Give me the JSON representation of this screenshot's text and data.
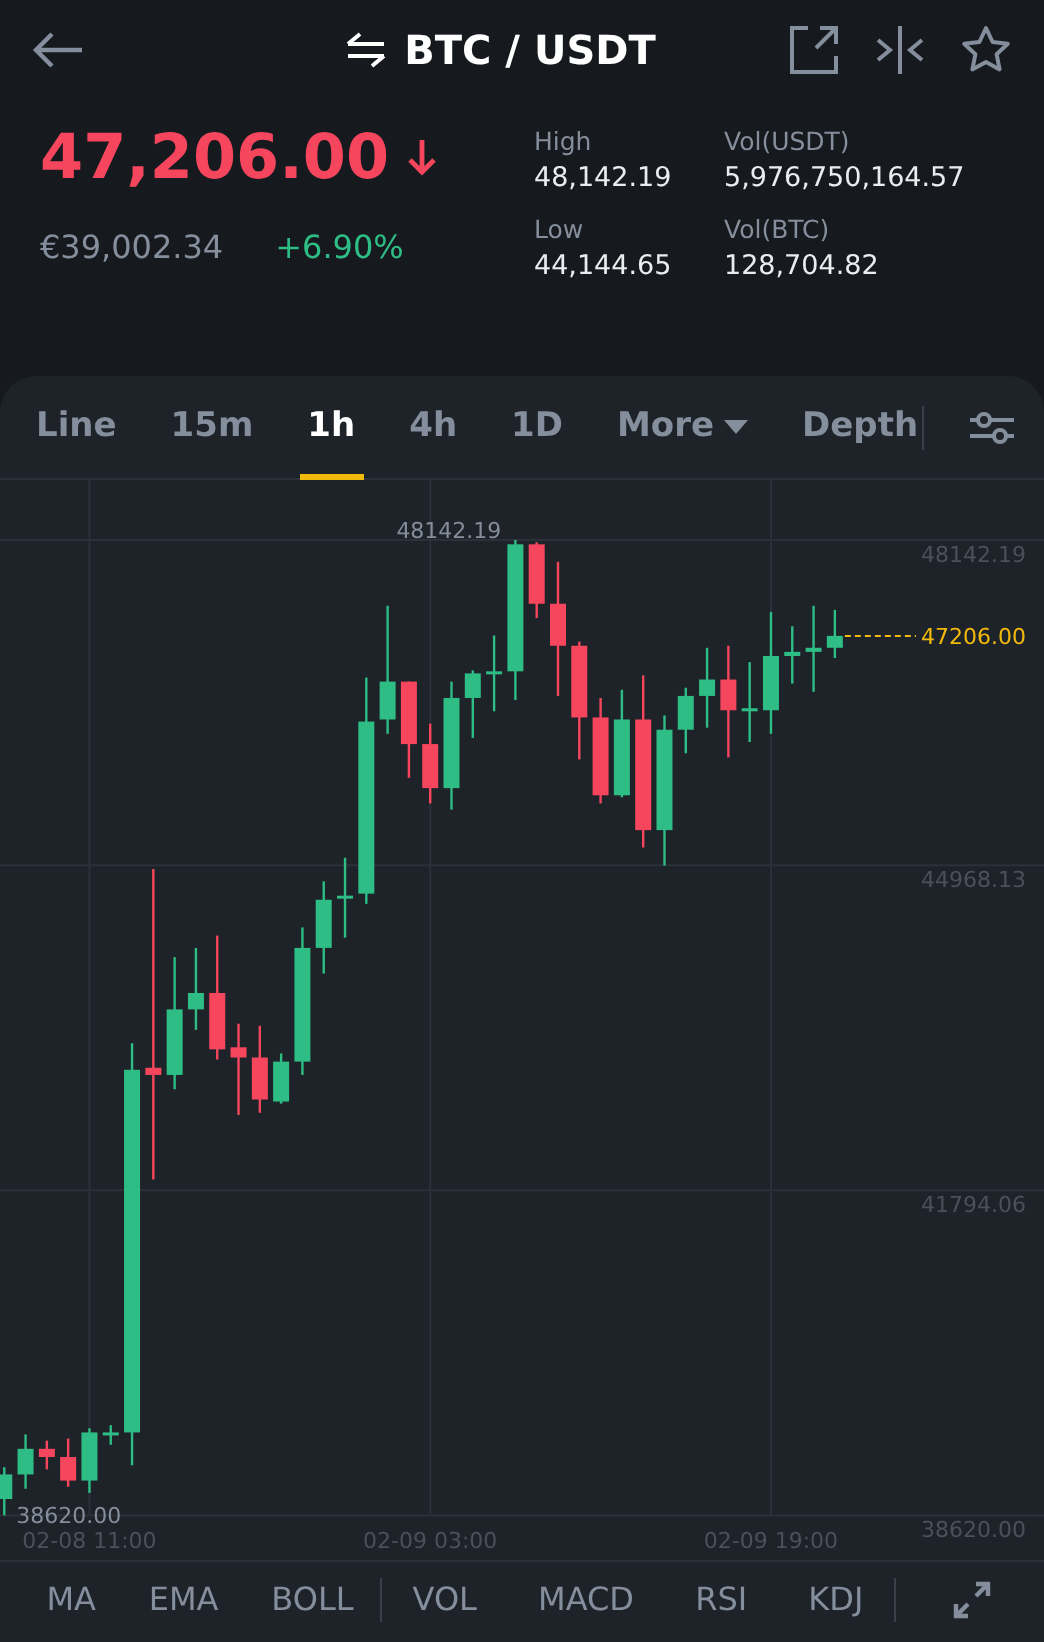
{
  "header": {
    "title": "BTC / USDT"
  },
  "ticker": {
    "price": "47,206.00",
    "falling": true,
    "fiat": "€39,002.34",
    "change": "+6.90%",
    "stats": [
      {
        "label": "High",
        "value": "48,142.19"
      },
      {
        "label": "Vol(USDT)",
        "value": "5,976,750,164.57"
      },
      {
        "label": "Low",
        "value": "44,144.65"
      },
      {
        "label": "Vol(BTC)",
        "value": "128,704.82"
      }
    ]
  },
  "intervals": [
    {
      "label": "Line",
      "selected": false,
      "kind": "tab"
    },
    {
      "label": "15m",
      "selected": false,
      "kind": "tab"
    },
    {
      "label": "1h",
      "selected": true,
      "kind": "tab"
    },
    {
      "label": "4h",
      "selected": false,
      "kind": "tab"
    },
    {
      "label": "1D",
      "selected": false,
      "kind": "tab"
    },
    {
      "label": "More",
      "selected": false,
      "kind": "dropdown"
    },
    {
      "label": "Depth",
      "selected": false,
      "kind": "tab"
    }
  ],
  "chart": {
    "chart_data": {
      "type": "candlestick",
      "categories": [
        null,
        null,
        null,
        null,
        "02-08 11:00",
        null,
        null,
        null,
        null,
        null,
        null,
        null,
        null,
        null,
        null,
        null,
        null,
        null,
        null,
        null,
        "02-09 03:00",
        null,
        null,
        null,
        null,
        null,
        null,
        null,
        null,
        null,
        null,
        null,
        null,
        null,
        null,
        null,
        "02-09 19:00",
        null,
        null,
        null
      ],
      "ohlc": [
        [
          38780,
          39090,
          38620,
          39020
        ],
        [
          39020,
          39410,
          38880,
          39270
        ],
        [
          39270,
          39350,
          39070,
          39190
        ],
        [
          39190,
          39370,
          38900,
          38960
        ],
        [
          38960,
          39470,
          38840,
          39430
        ],
        [
          39410,
          39500,
          39310,
          39430
        ],
        [
          39430,
          43230,
          39110,
          42970
        ],
        [
          42990,
          44930,
          41900,
          42920
        ],
        [
          42920,
          44070,
          42780,
          43560
        ],
        [
          43560,
          44160,
          43360,
          43720
        ],
        [
          43720,
          44280,
          43070,
          43170
        ],
        [
          43190,
          43420,
          42530,
          43090
        ],
        [
          43090,
          43400,
          42550,
          42680
        ],
        [
          42660,
          43130,
          42640,
          43050
        ],
        [
          43050,
          44360,
          42920,
          44160
        ],
        [
          44160,
          44810,
          43910,
          44630
        ],
        [
          44650,
          45040,
          44260,
          44670
        ],
        [
          44690,
          46800,
          44590,
          46370
        ],
        [
          46390,
          47500,
          46250,
          46760
        ],
        [
          46760,
          46760,
          45820,
          46150
        ],
        [
          46150,
          46350,
          45570,
          45720
        ],
        [
          45720,
          46760,
          45510,
          46600
        ],
        [
          46600,
          46870,
          46210,
          46840
        ],
        [
          46840,
          47210,
          46470,
          46860
        ],
        [
          46860,
          48142.19,
          46580,
          48100
        ],
        [
          48100,
          48120,
          47380,
          47520
        ],
        [
          47520,
          47930,
          46620,
          47110
        ],
        [
          47110,
          47150,
          46000,
          46410
        ],
        [
          46410,
          46600,
          45570,
          45650
        ],
        [
          45650,
          46680,
          45630,
          46390
        ],
        [
          46390,
          46820,
          45140,
          45310
        ],
        [
          45310,
          46430,
          44964,
          46290
        ],
        [
          46290,
          46700,
          46060,
          46620
        ],
        [
          46620,
          47090,
          46310,
          46780
        ],
        [
          46780,
          47110,
          46020,
          46480
        ],
        [
          46470,
          46950,
          46170,
          46500
        ],
        [
          46480,
          47440,
          46250,
          47010
        ],
        [
          47010,
          47300,
          46740,
          47050
        ],
        [
          47050,
          47500,
          46660,
          47090
        ],
        [
          47090,
          47460,
          46990,
          47206
        ]
      ],
      "grid": true,
      "ylim": [
        38620,
        48728
      ],
      "yticks": [
        {
          "value": 48142.19,
          "label": "48142.19"
        },
        {
          "value": 44968.13,
          "label": "44968.13"
        },
        {
          "value": 41794.06,
          "label": "41794.06"
        },
        {
          "value": 38620,
          "label": "38620.00"
        }
      ],
      "annotations": [
        "48142.19",
        "38620.00",
        "47206.00"
      ]
    }
  },
  "main_indicators": [
    "MA",
    "EMA",
    "BOLL"
  ],
  "sub_indicators": [
    "VOL",
    "MACD",
    "RSI",
    "KDJ"
  ]
}
